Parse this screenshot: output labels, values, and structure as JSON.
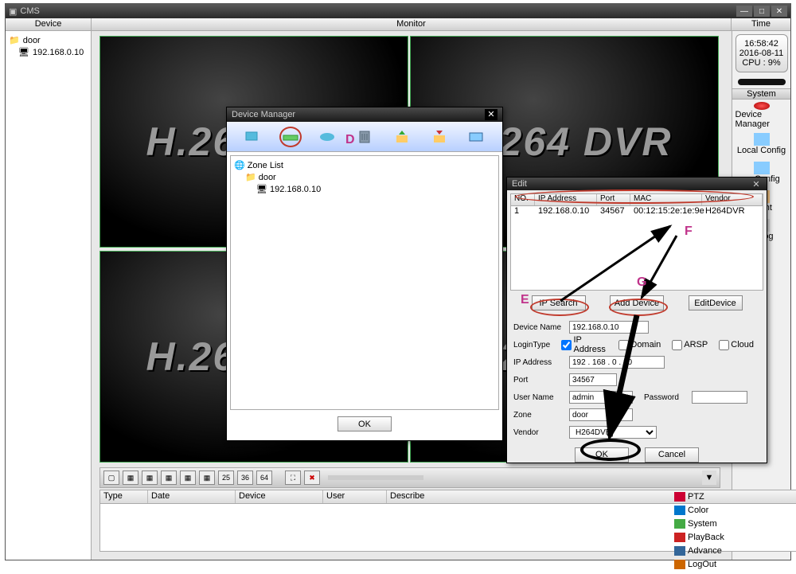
{
  "app_title": "CMS",
  "segments": {
    "device": "Device",
    "monitor": "Monitor",
    "time": "Time"
  },
  "tree": {
    "root": "door",
    "child": "192.168.0.10"
  },
  "clock": {
    "time": "16:58:42",
    "date": "2016-08-11",
    "cpu": "CPU : 9%"
  },
  "system_header": "System",
  "right_items": [
    "Device Manager",
    "Local Config",
    "ce Config",
    "count",
    "al Log"
  ],
  "video_text": "H.264 DVR",
  "layout_buttons": [
    "1",
    "4",
    "6",
    "8",
    "9",
    "16",
    "25",
    "36",
    "64"
  ],
  "bottom_cols": {
    "type": "Type",
    "date": "Date",
    "device": "Device",
    "user": "User",
    "describe": "Describe"
  },
  "rmenu": [
    "PTZ",
    "Color",
    "System",
    "PlayBack",
    "Advance",
    "LogOut"
  ],
  "rmenu_colors": [
    "#c03",
    "#07c",
    "#4a4",
    "#c22",
    "#369",
    "#c60"
  ],
  "dlg1": {
    "title": "Device Manager",
    "zone_list": "Zone List",
    "door": "door",
    "ip": "192.168.0.10",
    "ok": "OK"
  },
  "dlg2": {
    "title": "Edit",
    "cols": {
      "no": "NO.",
      "ip": "IP Address",
      "port": "Port",
      "mac": "MAC",
      "vendor": "Vendor"
    },
    "row": {
      "no": "1",
      "ip": "192.168.0.10",
      "port": "34567",
      "mac": "00:12:15:2e:1e:9e",
      "vendor": "H264DVR"
    },
    "btn_search": "IP Search",
    "btn_add": "Add Device",
    "btn_edit": "EditDevice",
    "lbl_devname": "Device Name",
    "val_devname": "192.168.0.10",
    "lbl_logintype": "LoginType",
    "chk_ip": "IP Address",
    "chk_domain": "Domain",
    "chk_arsp": "ARSP",
    "chk_cloud": "Cloud",
    "lbl_ip": "IP Address",
    "val_ip": "192 . 168 . 0 . 10",
    "lbl_port": "Port",
    "val_port": "34567",
    "lbl_user": "User Name",
    "val_user": "admin",
    "lbl_pass": "Password",
    "lbl_zone": "Zone",
    "val_zone": "door",
    "lbl_vendor": "Vendor",
    "val_vendor": "H264DVR",
    "ok": "OK",
    "cancel": "Cancel"
  },
  "annotations": {
    "D": "D",
    "E": "E",
    "F": "F",
    "G": "G"
  }
}
